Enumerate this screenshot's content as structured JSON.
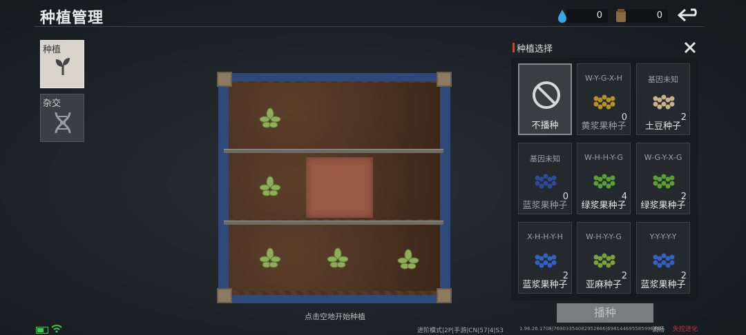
{
  "header": {
    "title": "种植管理",
    "water_count": "0",
    "fertilizer_count": "0"
  },
  "tabs": [
    {
      "label": "种植"
    },
    {
      "label": "杂交"
    }
  ],
  "field": {
    "hint": "点击空地开始种植"
  },
  "panel": {
    "title": "种植选择",
    "cards": [
      {
        "code": "",
        "name": "不播种",
        "count": "",
        "seed_color": "none"
      },
      {
        "code": "W-Y-G-X-H",
        "name": "黄浆果种子",
        "count": "0",
        "seed_color": "#b8902a"
      },
      {
        "code": "基因未知",
        "name": "土豆种子",
        "count": "2",
        "seed_color": "#c8b08a"
      },
      {
        "code": "基因未知",
        "name": "蓝浆果种子",
        "count": "0",
        "seed_color": "#2b4c9a"
      },
      {
        "code": "W-H-H-Y-G",
        "name": "绿浆果种子",
        "count": "4",
        "seed_color": "#5aa034"
      },
      {
        "code": "W-G-Y-X-G",
        "name": "绿浆果种子",
        "count": "2",
        "seed_color": "#5aa034"
      },
      {
        "code": "X-H-H-Y-H",
        "name": "蓝浆果种子",
        "count": "2",
        "seed_color": "#3560c0"
      },
      {
        "code": "W-H-Y-Y-G",
        "name": "亚麻种子",
        "count": "2",
        "seed_color": "#7aa040"
      },
      {
        "code": "Y-Y-Y-Y-Y",
        "name": "蓝浆果种子",
        "count": "2",
        "seed_color": "#3560c0"
      }
    ],
    "plant_button": "播种"
  },
  "status": {
    "mode": "进阶模式|2P|手游|CN|57|4|S3",
    "version": "1.96.26.1708|76903354082952666|69814469558599681",
    "fluency": "流畅",
    "logo": "失控进化"
  }
}
